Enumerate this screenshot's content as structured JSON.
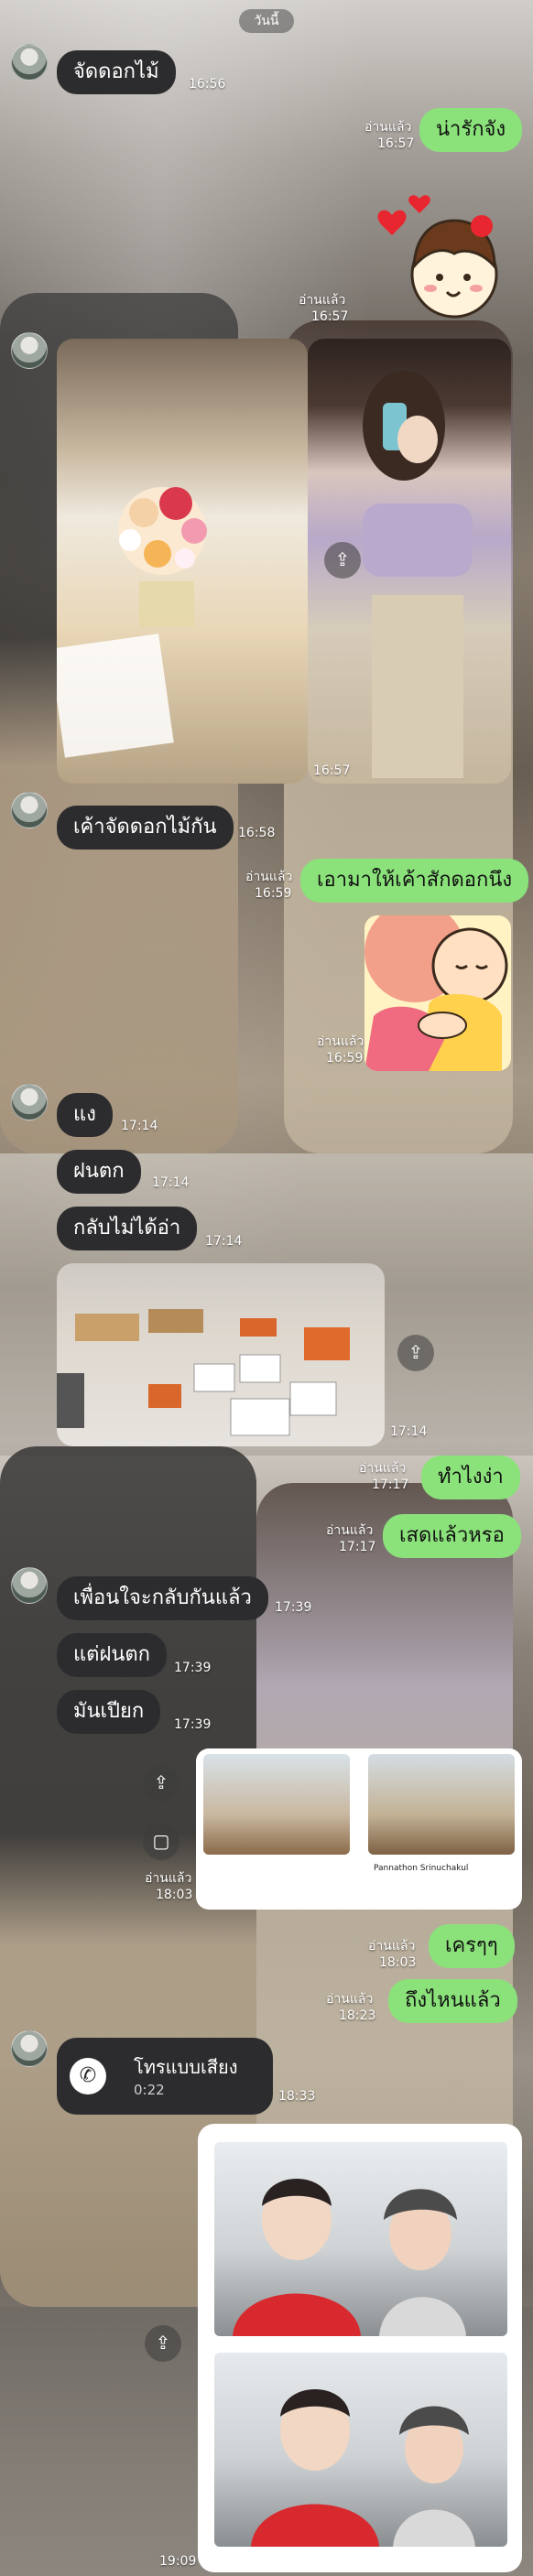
{
  "date_label": "วันนี้",
  "messages": {
    "m1": {
      "text": "จัดดอกไม้",
      "time": "16:56"
    },
    "m2": {
      "text": "น่ารักจัง",
      "read": "อ่านแล้ว",
      "time": "16:57"
    },
    "m3": {
      "read": "อ่านแล้ว",
      "time": "16:57"
    },
    "m4": {
      "time": "16:57"
    },
    "m5": {
      "text": "เค้าจัดดอกไม้กัน",
      "time": "16:58"
    },
    "m6": {
      "text": "เอามาให้เค้าสักดอกนึง",
      "read": "อ่านแล้ว",
      "time": "16:59"
    },
    "m7": {
      "read": "อ่านแล้ว",
      "time": "16:59"
    },
    "m8": {
      "text": "แง",
      "time": "17:14"
    },
    "m9": {
      "text": "ฝนตก",
      "time": "17:14"
    },
    "m10": {
      "text": "กลับไม่ได้อ่า",
      "time": "17:14"
    },
    "m11": {
      "time": "17:14"
    },
    "m12": {
      "text": "ทำไงง่า",
      "read": "อ่านแล้ว",
      "time": "17:17"
    },
    "m13": {
      "text": "เสดแล้วหรอ",
      "read": "อ่านแล้ว",
      "time": "17:17"
    },
    "m14": {
      "text": "เพื่อนใจะกลับกันแล้ว",
      "time": "17:39"
    },
    "m15": {
      "text": "แต่ฝนตก",
      "time": "17:39"
    },
    "m16": {
      "text": "มันเปียก",
      "time": "17:39"
    },
    "m17": {
      "read": "อ่านแล้ว",
      "time": "18:03"
    },
    "m18": {
      "text": "เครๆๆ",
      "read": "อ่านแล้ว",
      "time": "18:03"
    },
    "m19": {
      "text": "ถึงไหนแล้ว",
      "read": "อ่านแล้ว",
      "time": "18:23"
    },
    "call": {
      "title": "โทรแบบเสียง",
      "duration": "0:22",
      "time": "18:33"
    },
    "m20": {
      "time": "19:09"
    }
  },
  "preview": {
    "caption": "Pannathon Srinuchakul"
  },
  "icons": {
    "share": "share-icon",
    "crop": "crop-icon",
    "phone": "phone-icon",
    "avatar": "avatar-icon"
  },
  "colors": {
    "incoming_bubble": "#2c2c2e",
    "outgoing_bubble": "#8be27a"
  }
}
